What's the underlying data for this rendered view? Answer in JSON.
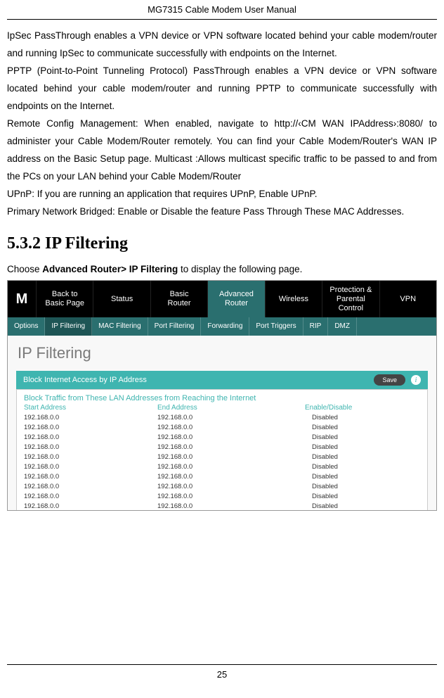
{
  "header": "MG7315 Cable Modem User Manual",
  "footer": "25",
  "paragraphs": {
    "p1": "IpSec PassThrough enables a VPN device or VPN software located behind your cable modem/router and running IpSec to communicate successfully with endpoints on the Internet.",
    "p2": "PPTP (Point-to-Point Tunneling Protocol) PassThrough enables a VPN device or VPN software located behind your cable modem/router and running PPTP to communicate successfully with endpoints on the Internet.",
    "p3": "Remote Config Management: When enabled, navigate to http://‹CM WAN IPAddress›:8080/ to administer your Cable Modem/Router remotely. You can find your Cable Modem/Router's WAN IP address on the Basic Setup page. Multicast :Allows multicast specific traffic to be passed to and from the PCs on your LAN behind your Cable Modem/Router",
    "p4": "UPnP: If you are running an application that requires UPnP, Enable UPnP.",
    "p5": "Primary Network Bridged: Enable or Disable the feature Pass Through These MAC Addresses."
  },
  "section_heading": "5.3.2   IP Filtering",
  "intro_prefix": "Choose ",
  "intro_bold": "Advanced Router> IP Filtering",
  "intro_suffix": " to display the following page.",
  "topnav": {
    "logo": "M",
    "items": [
      {
        "line1": "Back to",
        "line2": "Basic Page"
      },
      {
        "line1": "Status",
        "line2": ""
      },
      {
        "line1": "Basic",
        "line2": "Router"
      },
      {
        "line1": "Advanced",
        "line2": "Router"
      },
      {
        "line1": "Wireless",
        "line2": ""
      },
      {
        "line1": "Protection &",
        "line2": "Parental Control"
      },
      {
        "line1": "VPN",
        "line2": ""
      }
    ]
  },
  "subnav": [
    "Options",
    "IP Filtering",
    "MAC Filtering",
    "Port Filtering",
    "Forwarding",
    "Port Triggers",
    "RIP",
    "DMZ"
  ],
  "panel": {
    "title": "IP Filtering",
    "block_header": "Block Internet Access by IP Address",
    "save": "Save",
    "info": "i",
    "subtitle": "Block Traffic from These LAN Addresses from Reaching the Internet",
    "col_start": "Start Address",
    "col_end": "End Address",
    "col_enable": "Enable/Disable"
  },
  "chart_data": {
    "type": "table",
    "columns": [
      "Start Address",
      "End Address",
      "Enable/Disable"
    ],
    "rows": [
      [
        "192.168.0.0",
        "192.168.0.0",
        "Disabled"
      ],
      [
        "192.168.0.0",
        "192.168.0.0",
        "Disabled"
      ],
      [
        "192.168.0.0",
        "192.168.0.0",
        "Disabled"
      ],
      [
        "192.168.0.0",
        "192.168.0.0",
        "Disabled"
      ],
      [
        "192.168.0.0",
        "192.168.0.0",
        "Disabled"
      ],
      [
        "192.168.0.0",
        "192.168.0.0",
        "Disabled"
      ],
      [
        "192.168.0.0",
        "192.168.0.0",
        "Disabled"
      ],
      [
        "192.168.0.0",
        "192.168.0.0",
        "Disabled"
      ],
      [
        "192.168.0.0",
        "192.168.0.0",
        "Disabled"
      ],
      [
        "192.168.0.0",
        "192.168.0.0",
        "Disabled"
      ]
    ]
  }
}
